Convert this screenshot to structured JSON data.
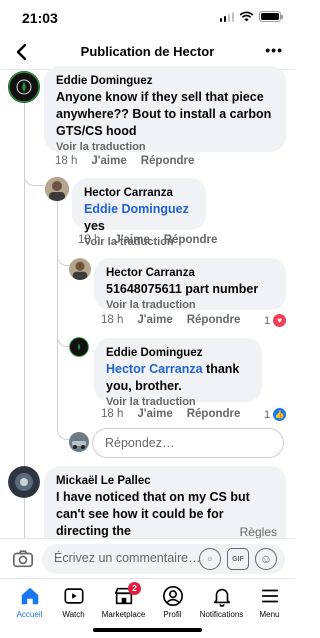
{
  "status": {
    "time": "21:03"
  },
  "header": {
    "title": "Publication de Hector",
    "more": "•••"
  },
  "comments": [
    {
      "author": "Eddie Dominguez",
      "text": "Anyone know if they sell that piece anywhere?? Bout to install a carbon GTS/CS hood",
      "translate": "Voir la traduction",
      "time": "18 h",
      "like": "J'aime",
      "reply": "Répondre"
    },
    {
      "author": "Hector Carranza",
      "mention": "Eddie Dominguez",
      "text": " yes",
      "translate": "Voir la traduction",
      "time": "18 h",
      "like": "J'aime",
      "reply": "Répondre"
    },
    {
      "author": "Hector Carranza",
      "text": "51648075611 part number",
      "translate": "Voir la traduction",
      "time": "18 h",
      "like": "J'aime",
      "reply": "Répondre",
      "reaction_count": "1"
    },
    {
      "author": "Eddie Dominguez",
      "mention": "Hector Carranza",
      "text": " thank you, brother.",
      "translate": "Voir la traduction",
      "time": "18 h",
      "like": "J'aime",
      "reply": "Répondre",
      "reaction_count": "1"
    },
    {
      "author": "Mickaël Le Pallec",
      "text": "I have noticed that on my CS but can't see how it could be for directing the"
    }
  ],
  "reply_placeholder": "Répondez…",
  "rules_link": "Règles",
  "composer": {
    "placeholder": "Écrivez un commentaire…",
    "gif": "GIF"
  },
  "tabs": [
    {
      "label": "Accueil",
      "icon": "home-icon",
      "active": true
    },
    {
      "label": "Watch",
      "icon": "watch-icon"
    },
    {
      "label": "Marketplace",
      "icon": "marketplace-icon",
      "badge": "2"
    },
    {
      "label": "Profil",
      "icon": "profile-icon"
    },
    {
      "label": "Notifications",
      "icon": "bell-icon"
    },
    {
      "label": "Menu",
      "icon": "menu-icon"
    }
  ],
  "colors": {
    "accent": "#1877f2",
    "mention": "#1f62d0",
    "love": "#f33e58",
    "like": "#1877f2",
    "badge": "#e41e3f"
  }
}
